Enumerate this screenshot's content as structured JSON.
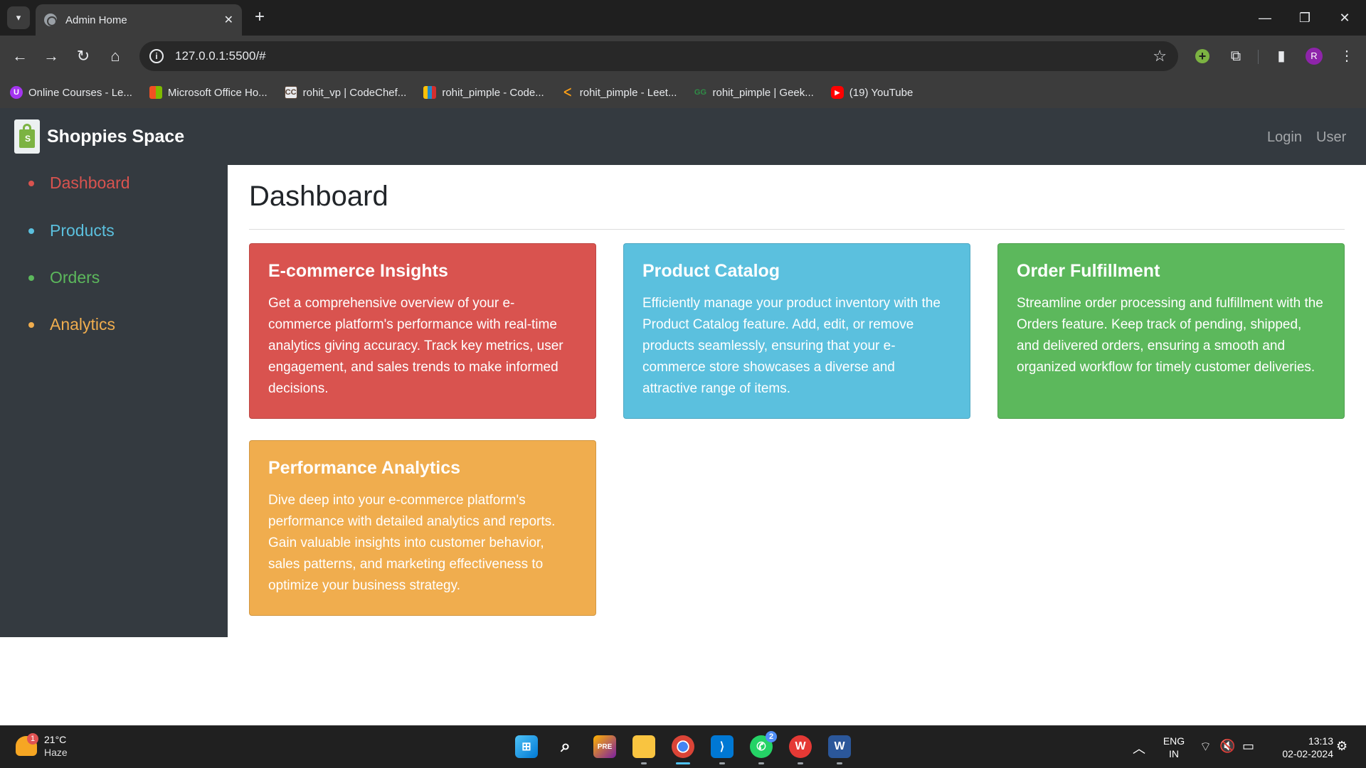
{
  "browser": {
    "tab_title": "Admin Home",
    "url": "127.0.0.1:5500/#",
    "profile_initial": "R",
    "bookmarks": [
      {
        "label": "Online Courses - Le...",
        "icon": "udemy-icon",
        "color": "#a435f0"
      },
      {
        "label": "Microsoft Office Ho...",
        "icon": "microsoft-icon",
        "color": "#f25022"
      },
      {
        "label": "rohit_vp | CodeChef...",
        "icon": "codechef-icon",
        "color": "#5b4638"
      },
      {
        "label": "rohit_pimple - Code...",
        "icon": "codeforces-icon",
        "color": "#1f8acb"
      },
      {
        "label": "rohit_pimple - Leet...",
        "icon": "leetcode-icon",
        "color": "#ffa116"
      },
      {
        "label": "rohit_pimple | Geek...",
        "icon": "geeksforgeeks-icon",
        "color": "#2f8d46"
      },
      {
        "label": "(19) YouTube",
        "icon": "youtube-icon",
        "color": "#ff0000"
      }
    ]
  },
  "navbar": {
    "brand": "Shoppies Space",
    "links": [
      "Login",
      "User"
    ]
  },
  "sidebar": {
    "items": [
      {
        "label": "Dashboard",
        "color": "#d9534f"
      },
      {
        "label": "Products",
        "color": "#5bc0de"
      },
      {
        "label": "Orders",
        "color": "#5cb85c"
      },
      {
        "label": "Analytics",
        "color": "#f0ad4e"
      }
    ]
  },
  "main": {
    "title": "Dashboard",
    "cards": [
      {
        "title": "E-commerce Insights",
        "text": "Get a comprehensive overview of your e-commerce platform's performance with real-time analytics giving accuracy. Track key metrics, user engagement, and sales trends to make informed decisions.",
        "color": "#d9534f"
      },
      {
        "title": "Product Catalog",
        "text": "Efficiently manage your product inventory with the Product Catalog feature. Add, edit, or remove products seamlessly, ensuring that your e-commerce store showcases a diverse and attractive range of items.",
        "color": "#5bc0de"
      },
      {
        "title": "Order Fulfillment",
        "text": "Streamline order processing and fulfillment with the Orders feature. Keep track of pending, shipped, and delivered orders, ensuring a smooth and organized workflow for timely customer deliveries.",
        "color": "#5cb85c"
      },
      {
        "title": "Performance Analytics",
        "text": "Dive deep into your e-commerce platform's performance with detailed analytics and reports. Gain valuable insights into customer behavior, sales patterns, and marketing effectiveness to optimize your business strategy.",
        "color": "#f0ad4e"
      }
    ]
  },
  "taskbar": {
    "weather_temp": "21°C",
    "weather_cond": "Haze",
    "weather_badge": "1",
    "whatsapp_badge": "2",
    "lang_line1": "ENG",
    "lang_line2": "IN",
    "time": "13:13",
    "date": "02-02-2024"
  }
}
